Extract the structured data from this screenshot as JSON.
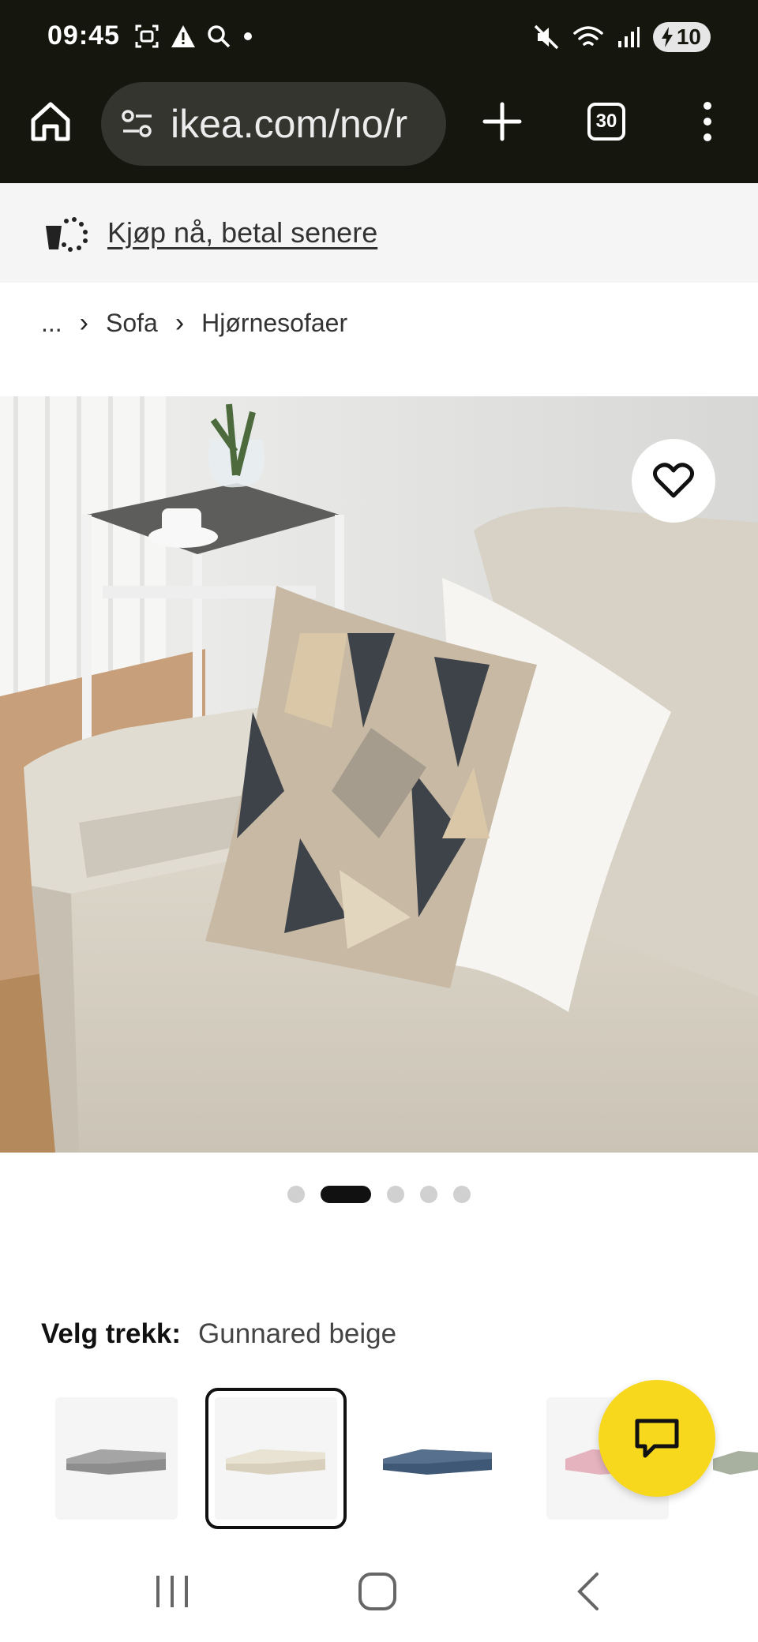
{
  "status_bar": {
    "time": "09:45",
    "icons_left": [
      "screenshot-icon",
      "warning-icon",
      "search-icon",
      "dot-icon"
    ],
    "icons_right": [
      "mute-icon",
      "wifi-icon",
      "signal-icon"
    ],
    "battery": "10"
  },
  "browser": {
    "url": "ikea.com/no/r",
    "tab_count": "30"
  },
  "banner": {
    "link_text": "Kjøp nå, betal senere"
  },
  "breadcrumb": {
    "items": [
      "...",
      "Sofa",
      "Hjørnesofaer"
    ]
  },
  "gallery": {
    "dot_count": 5,
    "active_index": 1
  },
  "cover": {
    "label": "Velg trekk:",
    "value": "Gunnared beige",
    "swatches": [
      {
        "color": "#8d8d8d",
        "selected": false
      },
      {
        "color": "#e9e3d4",
        "selected": true
      },
      {
        "color": "#3e5876",
        "selected": false
      },
      {
        "color": "#e5b3bd",
        "selected": false
      },
      {
        "color": "#a8b0a0",
        "selected": false
      }
    ]
  },
  "colors": {
    "chrome_bg": "#15170f",
    "accent_yellow": "#f8d81c"
  }
}
